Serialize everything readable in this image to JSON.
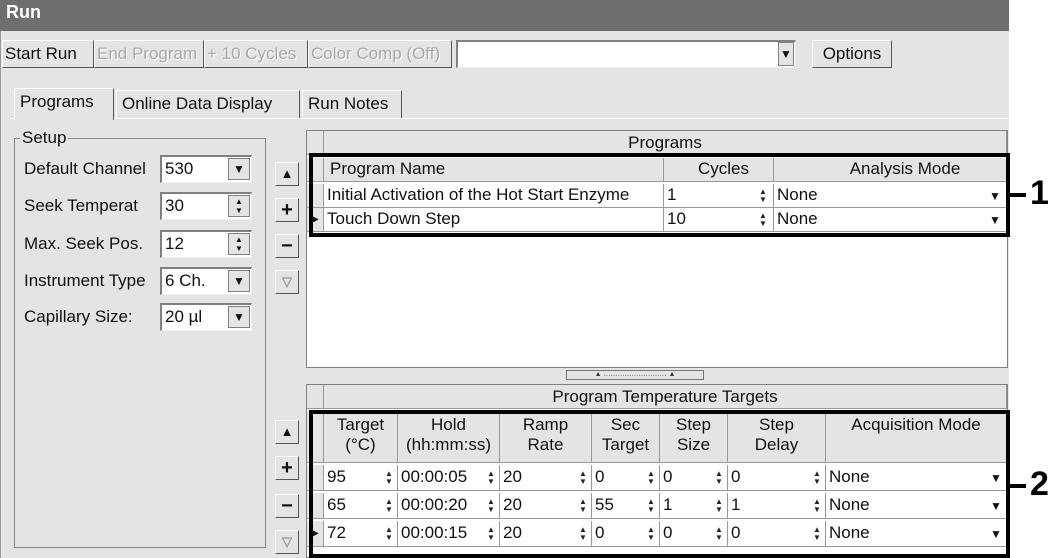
{
  "window": {
    "title": "Run"
  },
  "toolbar": {
    "start_run": "Start Run",
    "end_program": "End Program",
    "plus_10_cycles": "+ 10 Cycles",
    "color_comp": "Color Comp (Off)",
    "options": "Options"
  },
  "tabs": [
    "Programs",
    "Online Data Display",
    "Run Notes"
  ],
  "setup": {
    "title": "Setup",
    "fields": [
      {
        "label": "Default Channel",
        "value": "530"
      },
      {
        "label": "Seek Temperat",
        "value": "30"
      },
      {
        "label": "Max. Seek Pos.",
        "value": "12"
      },
      {
        "label": "Instrument Type",
        "value": "6 Ch."
      },
      {
        "label": "Capillary Size:",
        "value": "20 µl"
      }
    ]
  },
  "programs": {
    "title": "Programs",
    "columns": [
      "Program Name",
      "Cycles",
      "Analysis Mode"
    ],
    "rows": [
      {
        "name": "Initial Activation of the Hot Start Enzyme",
        "cycles": "1",
        "mode": "None"
      },
      {
        "name": "Touch Down Step",
        "cycles": "10",
        "mode": "None"
      }
    ]
  },
  "targets": {
    "title": "Program Temperature Targets",
    "columns": [
      [
        "Target",
        "(°C)"
      ],
      [
        "Hold",
        "(hh:mm:ss)"
      ],
      [
        "Ramp",
        "Rate"
      ],
      [
        "Sec",
        "Target"
      ],
      [
        "Step",
        "Size"
      ],
      [
        "Step",
        "Delay"
      ],
      [
        "Acquisition Mode",
        ""
      ]
    ],
    "rows": [
      [
        "95",
        "00:00:05",
        "20",
        "0",
        "0",
        "0",
        "None"
      ],
      [
        "65",
        "00:00:20",
        "20",
        "55",
        "1",
        "1",
        "None"
      ],
      [
        "72",
        "00:00:15",
        "20",
        "0",
        "0",
        "0",
        "None"
      ]
    ]
  },
  "callouts": [
    "1",
    "2"
  ],
  "side_buttons": {
    "up": "▲",
    "add": "+",
    "remove": "−",
    "down": "▽"
  }
}
